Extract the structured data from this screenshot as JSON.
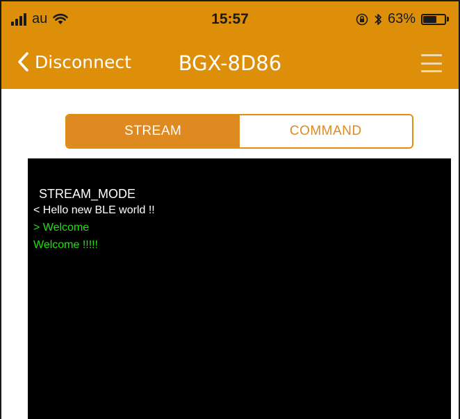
{
  "status_bar": {
    "carrier": "au",
    "time": "15:57",
    "battery_percent_label": "63%",
    "battery_level": 0.63,
    "icons": [
      "signal-icon",
      "wifi-icon",
      "orientation-lock-icon",
      "bluetooth-icon",
      "battery-icon"
    ]
  },
  "nav": {
    "back_label": "Disconnect",
    "title": "BGX-8D86",
    "menu_icon": "hamburger-menu-icon"
  },
  "tabs": {
    "stream_label": "STREAM",
    "command_label": "COMMAND",
    "selected": "STREAM"
  },
  "terminal": {
    "mode_line": "STREAM_MODE",
    "lines": [
      {
        "text": "< Hello new BLE world !!",
        "color": "#ffffff"
      },
      {
        "text": "> Welcome",
        "color": "#22e011"
      },
      {
        "text": "Welcome !!!!!",
        "color": "#22e011"
      }
    ],
    "mode_color": "#ffffff"
  },
  "colors": {
    "accent": "#dd8f0a",
    "segment_active": "#de8a20",
    "terminal_bg": "#000000",
    "received_text": "#22e011"
  }
}
